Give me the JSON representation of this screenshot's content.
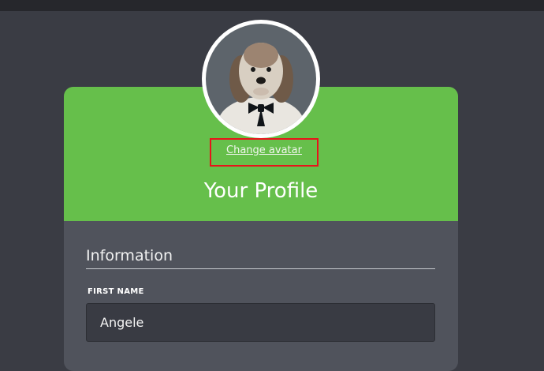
{
  "profile": {
    "change_avatar_label": "Change avatar",
    "title": "Your Profile",
    "avatar_icon": "dog-photo-avatar",
    "accent_color": "#66bf4b"
  },
  "information": {
    "section_title": "Information",
    "first_name": {
      "label": "FIRST NAME",
      "value": "Angele"
    }
  }
}
